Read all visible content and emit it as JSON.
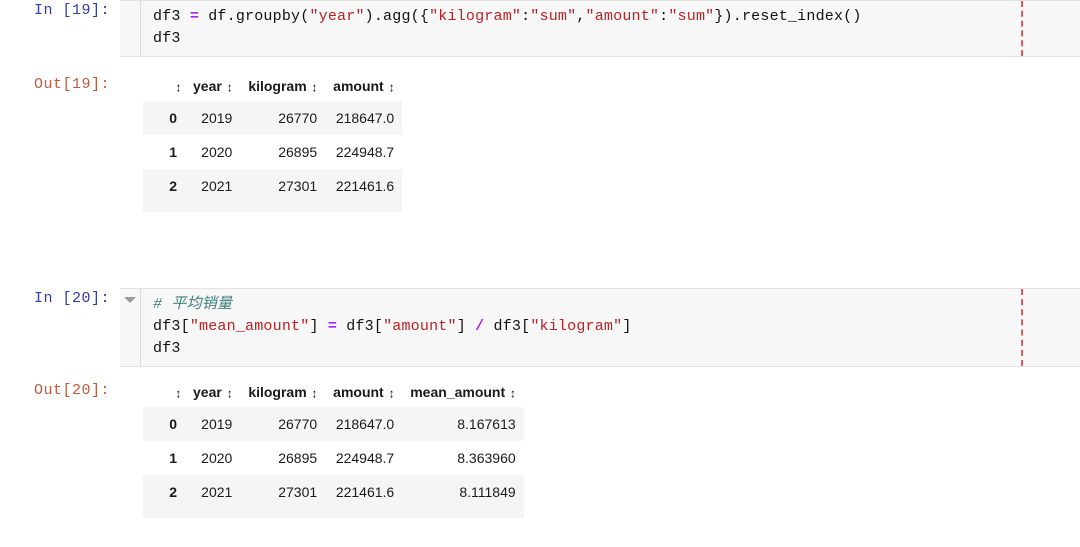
{
  "theme": {
    "code_bg": "#f7f7f7",
    "prompt_in_color": "#303f9f",
    "prompt_out_color": "#bf5b3d",
    "string_color": "#ba2121",
    "operator_color": "#aa22ff",
    "comment_color": "#408080",
    "ruler_color": "#e05c5c",
    "row_stripe_color": "#f5f5f5"
  },
  "icons": {
    "collapse_triangle": "chevron-down-icon",
    "sort_glyph": "↕"
  },
  "cells": [
    {
      "type": "code",
      "prompt": "In [19]:",
      "has_collapser": false,
      "code_lines": [
        [
          {
            "t": "df3 ",
            "k": "plain"
          },
          {
            "t": "=",
            "k": "op"
          },
          {
            "t": " df.groupby(",
            "k": "plain"
          },
          {
            "t": "\"year\"",
            "k": "str"
          },
          {
            "t": ").agg({",
            "k": "plain"
          },
          {
            "t": "\"kilogram\"",
            "k": "str"
          },
          {
            "t": ":",
            "k": "plain"
          },
          {
            "t": "\"sum\"",
            "k": "str"
          },
          {
            "t": ",",
            "k": "plain"
          },
          {
            "t": "\"amount\"",
            "k": "str"
          },
          {
            "t": ":",
            "k": "plain"
          },
          {
            "t": "\"sum\"",
            "k": "str"
          },
          {
            "t": "}).reset_index()",
            "k": "plain"
          }
        ],
        [
          {
            "t": "df3",
            "k": "plain"
          }
        ]
      ]
    },
    {
      "type": "output",
      "prompt": "Out[19]:",
      "table": {
        "index_header": "",
        "columns": [
          "year",
          "kilogram",
          "amount"
        ],
        "index": [
          "0",
          "1",
          "2"
        ],
        "rows": [
          [
            "2019",
            "26770",
            "218647.0"
          ],
          [
            "2020",
            "26895",
            "224948.7"
          ],
          [
            "2021",
            "27301",
            "221461.6"
          ]
        ]
      }
    },
    {
      "type": "code",
      "prompt": "In [20]:",
      "has_collapser": true,
      "code_lines": [
        [
          {
            "t": "# 平均销量",
            "k": "com"
          }
        ],
        [
          {
            "t": "df3[",
            "k": "plain"
          },
          {
            "t": "\"mean_amount\"",
            "k": "str"
          },
          {
            "t": "] ",
            "k": "plain"
          },
          {
            "t": "=",
            "k": "op"
          },
          {
            "t": " df3[",
            "k": "plain"
          },
          {
            "t": "\"amount\"",
            "k": "str"
          },
          {
            "t": "] ",
            "k": "plain"
          },
          {
            "t": "/",
            "k": "op"
          },
          {
            "t": " df3[",
            "k": "plain"
          },
          {
            "t": "\"kilogram\"",
            "k": "str"
          },
          {
            "t": "]",
            "k": "plain"
          }
        ],
        [
          {
            "t": "df3",
            "k": "plain"
          }
        ]
      ]
    },
    {
      "type": "output",
      "prompt": "Out[20]:",
      "table": {
        "index_header": "",
        "columns": [
          "year",
          "kilogram",
          "amount",
          "mean_amount"
        ],
        "index": [
          "0",
          "1",
          "2"
        ],
        "rows": [
          [
            "2019",
            "26770",
            "218647.0",
            "8.167613"
          ],
          [
            "2020",
            "26895",
            "224948.7",
            "8.363960"
          ],
          [
            "2021",
            "27301",
            "221461.6",
            "8.111849"
          ]
        ]
      }
    }
  ]
}
